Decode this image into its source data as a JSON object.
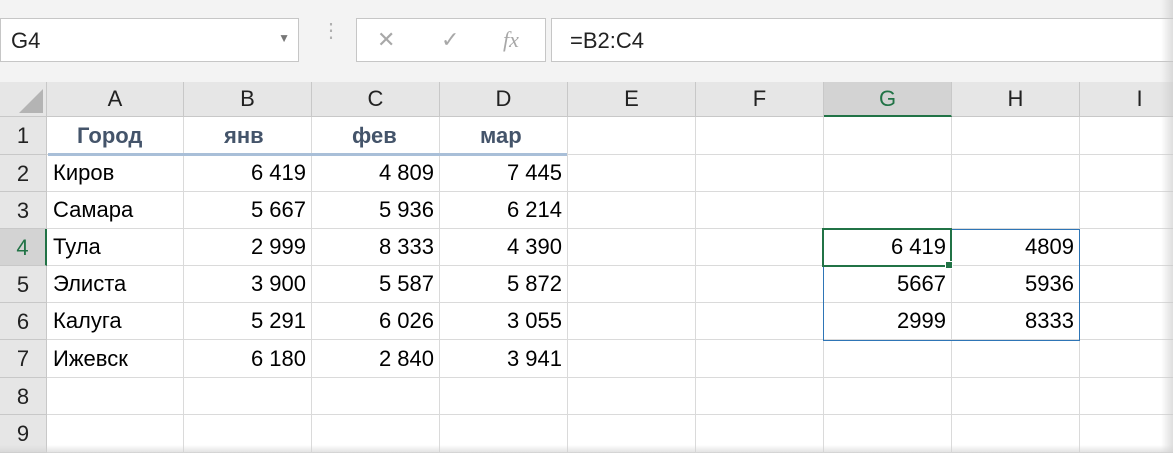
{
  "name_box": {
    "value": "G4",
    "dropdown_icon": "chevron-down-icon"
  },
  "formula_bar": {
    "cancel_icon": "✕",
    "enter_icon": "✓",
    "function_icon": "fx",
    "formula": "=B2:C4"
  },
  "columns": [
    "A",
    "B",
    "C",
    "D",
    "E",
    "F",
    "G",
    "H",
    "I"
  ],
  "selected_column": "G",
  "rows": [
    "1",
    "2",
    "3",
    "4",
    "5",
    "6",
    "7",
    "8",
    "9"
  ],
  "selected_row": "4",
  "table": {
    "headers": [
      "Город",
      "янв",
      "фев",
      "мар"
    ],
    "rows": [
      [
        "Киров",
        "6 419",
        "4 809",
        "7 445"
      ],
      [
        "Самара",
        "5 667",
        "5 936",
        "6 214"
      ],
      [
        "Тула",
        "2 999",
        "8 333",
        "4 390"
      ],
      [
        "Элиста",
        "3 900",
        "5 587",
        "5 872"
      ],
      [
        "Калуга",
        "5 291",
        "6 026",
        "3 055"
      ],
      [
        "Ижевск",
        "6 180",
        "2 840",
        "3 941"
      ]
    ]
  },
  "spill_range": {
    "rows": [
      [
        "6 419",
        "4809"
      ],
      [
        "5667",
        "5936"
      ],
      [
        "2999",
        "8333"
      ]
    ]
  },
  "colors": {
    "accent_green": "#217346",
    "spill_border": "#2e75b6",
    "header_text": "#44546a"
  }
}
